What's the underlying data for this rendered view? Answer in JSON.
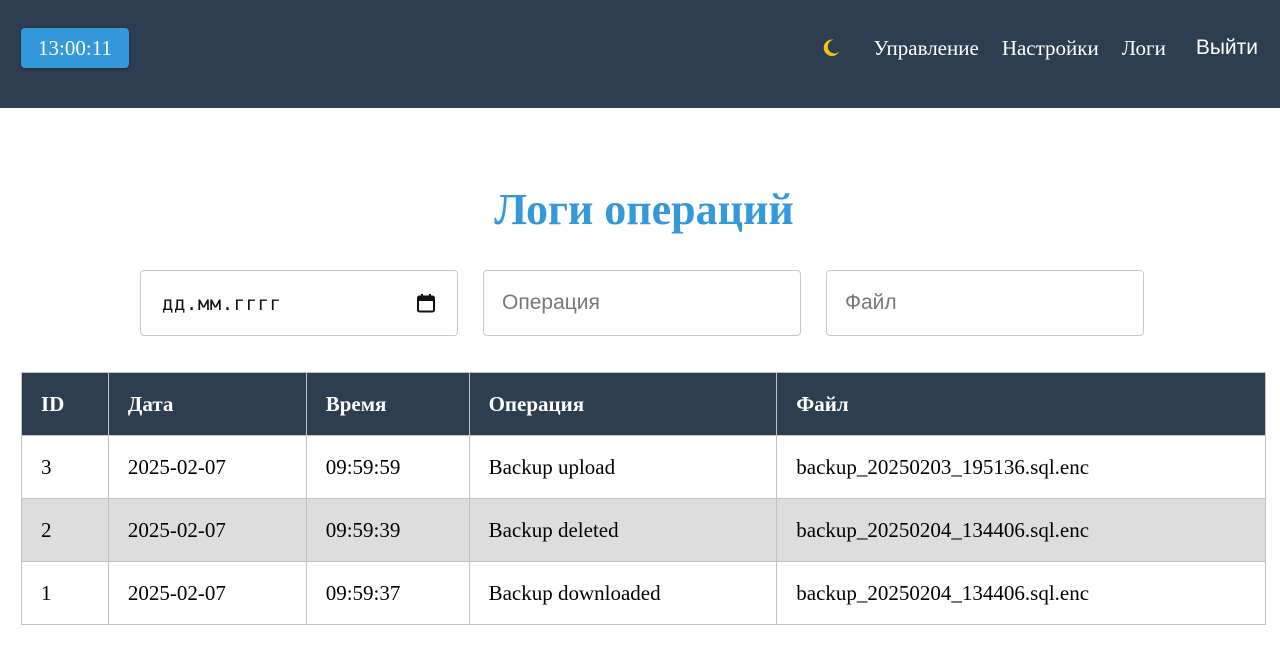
{
  "header": {
    "clock": "13:00:11",
    "theme_icon": "moon-icon",
    "nav": [
      "Управление",
      "Настройки",
      "Логи"
    ],
    "logout": "Выйти"
  },
  "page": {
    "title": "Логи операций"
  },
  "filters": {
    "date_placeholder": "дд.мм.гггг",
    "operation_placeholder": "Операция",
    "file_placeholder": "Файл"
  },
  "table": {
    "columns": [
      "ID",
      "Дата",
      "Время",
      "Операция",
      "Файл"
    ],
    "rows": [
      [
        "3",
        "2025-02-07",
        "09:59:59",
        "Backup upload",
        "backup_20250203_195136.sql.enc"
      ],
      [
        "2",
        "2025-02-07",
        "09:59:39",
        "Backup deleted",
        "backup_20250204_134406.sql.enc"
      ],
      [
        "1",
        "2025-02-07",
        "09:59:37",
        "Backup downloaded",
        "backup_20250204_134406.sql.enc"
      ]
    ]
  },
  "colors": {
    "navbar": "#2c3e50",
    "accent": "#3498db",
    "row_alt": "#dddddd"
  }
}
